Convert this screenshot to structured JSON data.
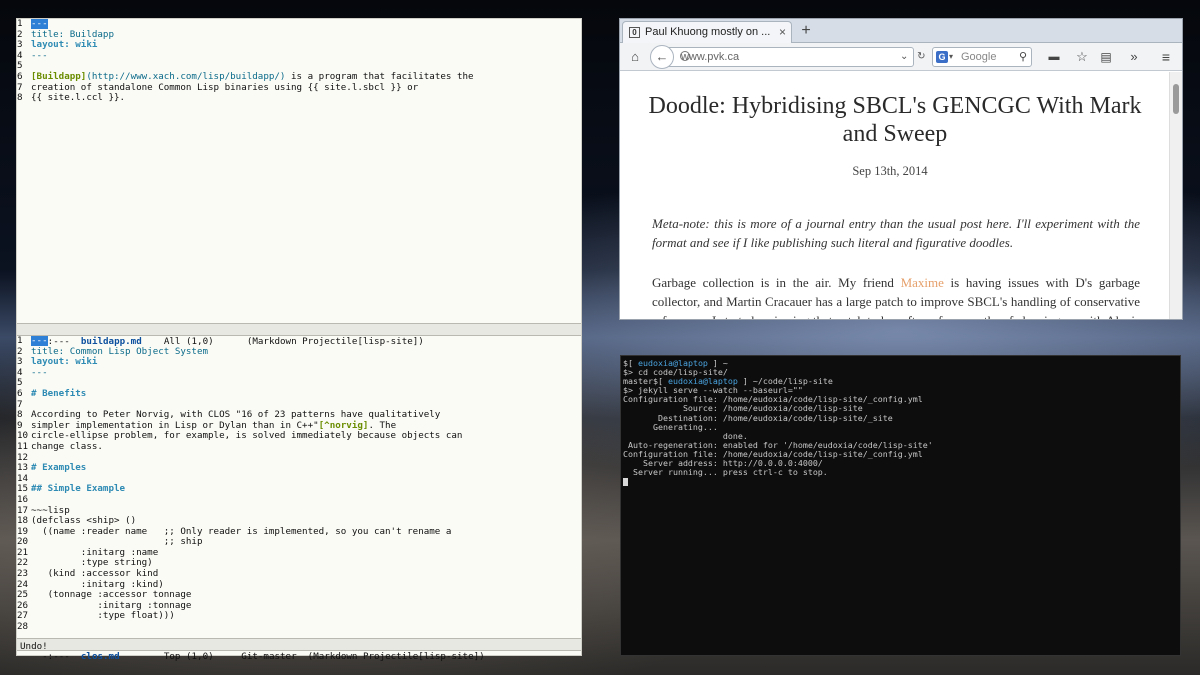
{
  "emacs": {
    "top_buffer": {
      "lines": [
        [
          {
            "t": "---",
            "c": "cursor"
          }
        ],
        [
          {
            "t": "title: ",
            "c": "key"
          },
          {
            "t": "Buildapp",
            "c": "fm"
          }
        ],
        [
          {
            "t": "layout: wiki",
            "c": "kw"
          }
        ],
        [
          {
            "t": "---",
            "c": "fm"
          }
        ],
        [],
        [
          {
            "t": "[Buildapp]",
            "c": "lnk"
          },
          {
            "t": "(http://www.xach.com/lisp/buildapp/)",
            "c": "url"
          },
          {
            "t": " is a program that facilitates the",
            "c": ""
          }
        ],
        [
          {
            "t": "creation of standalone Common Lisp binaries using {{ site.l.sbcl }} or",
            "c": ""
          }
        ],
        [
          {
            "t": "{{ site.l.ccl }}.",
            "c": ""
          }
        ]
      ],
      "modeline": {
        "prefix": "-:---  ",
        "buffer": "buildapp.md",
        "rest": "    All (1,0)      (Markdown Projectile[lisp-site])"
      }
    },
    "bottom_buffer": {
      "lines": [
        [
          {
            "t": "---",
            "c": "cursor"
          }
        ],
        [
          {
            "t": "title: ",
            "c": "key"
          },
          {
            "t": "Common Lisp Object System",
            "c": "fm"
          }
        ],
        [
          {
            "t": "layout: wiki",
            "c": "kw"
          }
        ],
        [
          {
            "t": "---",
            "c": "fm"
          }
        ],
        [],
        [
          {
            "t": "# Benefits",
            "c": "hd"
          }
        ],
        [],
        [
          {
            "t": "According to Peter Norvig, with CLOS \"16 of 23 patterns have qualitatively",
            "c": ""
          }
        ],
        [
          {
            "t": "simpler implementation in Lisp or Dylan than in C++\"",
            "c": ""
          },
          {
            "t": "[^norvig]",
            "c": "lnk"
          },
          {
            "t": ". The",
            "c": ""
          }
        ],
        [
          {
            "t": "circle-ellipse problem, for example, is solved immediately because objects can",
            "c": ""
          }
        ],
        [
          {
            "t": "change class.",
            "c": ""
          }
        ],
        [],
        [
          {
            "t": "# Examples",
            "c": "hd"
          }
        ],
        [],
        [
          {
            "t": "## Simple Example",
            "c": "hd"
          }
        ],
        [],
        [
          {
            "t": "~~~lisp",
            "c": ""
          }
        ],
        [
          {
            "t": "(defclass <ship> ()",
            "c": ""
          }
        ],
        [
          {
            "t": "  ((name :reader name   ;; Only reader is implemented, so you can't rename a",
            "c": ""
          }
        ],
        [
          {
            "t": "                        ;; ship",
            "c": ""
          }
        ],
        [
          {
            "t": "         :initarg :name",
            "c": ""
          }
        ],
        [
          {
            "t": "         :type string)",
            "c": ""
          }
        ],
        [
          {
            "t": "   (kind :accessor kind",
            "c": ""
          }
        ],
        [
          {
            "t": "         :initarg :kind)",
            "c": ""
          }
        ],
        [
          {
            "t": "   (tonnage :accessor tonnage",
            "c": ""
          }
        ],
        [
          {
            "t": "            :initarg :tonnage",
            "c": ""
          }
        ],
        [
          {
            "t": "            :type float)))",
            "c": ""
          }
        ],
        []
      ],
      "modeline": {
        "prefix": "-:---  ",
        "buffer": "clos.md",
        "rest": "        Top (1,0)     Git-master  (Markdown Projectile[lisp-site])"
      }
    },
    "minibuffer": "Undo!"
  },
  "firefox": {
    "tab_title": "Paul Khuong mostly on ...",
    "tab_favicon": "0",
    "url": "www.pvk.ca",
    "search_engine": "G",
    "search_placeholder": "Google",
    "icons": [
      "home-icon",
      "back-icon",
      "globe-icon",
      "dropdown-icon",
      "reload-icon",
      "search-icon",
      "addon-icon",
      "star-icon",
      "clipboard-icon",
      "overflow-icon",
      "menu-icon"
    ],
    "post": {
      "title": "Doodle: Hybridising SBCL's GENCGC With Mark and Sweep",
      "date": "Sep 13th, 2014",
      "meta_note": "Meta-note: this is more of a journal entry than the usual post here. I'll experiment with the format and see if I like publishing such literal and figurative doodles.",
      "body_before": "Garbage collection is in the air. My friend ",
      "body_link": "Maxime",
      "body_after": " is having issues with D's garbage collector, and Martin Cracauer has a large patch to improve SBCL's handling of conservative references. I started reviewing that patch today, after a few months of cleaning up with Alexis Petit..."
    }
  },
  "terminal": {
    "lines": [
      [
        {
          "t": "$[ ",
          "c": ""
        },
        {
          "t": "eudoxia@laptop",
          "c": "tuser"
        },
        {
          "t": " ] ~",
          "c": ""
        }
      ],
      [
        {
          "t": "$> cd code/lisp-site/",
          "c": ""
        }
      ],
      [
        {
          "t": "master$[ ",
          "c": ""
        },
        {
          "t": "eudoxia@laptop",
          "c": "tuser"
        },
        {
          "t": " ] ~/code/lisp-site",
          "c": ""
        }
      ],
      [
        {
          "t": "$> jekyll serve --watch --baseurl=\"\"",
          "c": ""
        }
      ],
      [
        {
          "t": "Configuration file: /home/eudoxia/code/lisp-site/_config.yml",
          "c": ""
        }
      ],
      [
        {
          "t": "            Source: /home/eudoxia/code/lisp-site",
          "c": ""
        }
      ],
      [
        {
          "t": "       Destination: /home/eudoxia/code/lisp-site/_site",
          "c": ""
        }
      ],
      [
        {
          "t": "      Generating...",
          "c": ""
        }
      ],
      [
        {
          "t": "                    done.",
          "c": ""
        }
      ],
      [
        {
          "t": " Auto-regeneration: enabled for '/home/eudoxia/code/lisp-site'",
          "c": ""
        }
      ],
      [
        {
          "t": "Configuration file: /home/eudoxia/code/lisp-site/_config.yml",
          "c": ""
        }
      ],
      [
        {
          "t": "    Server address: http://0.0.0.0:4000/",
          "c": ""
        }
      ],
      [
        {
          "t": "  Server running... press ctrl-c to stop.",
          "c": ""
        }
      ]
    ]
  },
  "colors": {
    "emacs_bg": "#fbfbf6",
    "link": "#6a8d00",
    "keyword": "#2e8bb3",
    "terminal_bg": "#0d0d0d",
    "terminal_user": "#4aa3df",
    "accent_link": "#e6a06b"
  }
}
